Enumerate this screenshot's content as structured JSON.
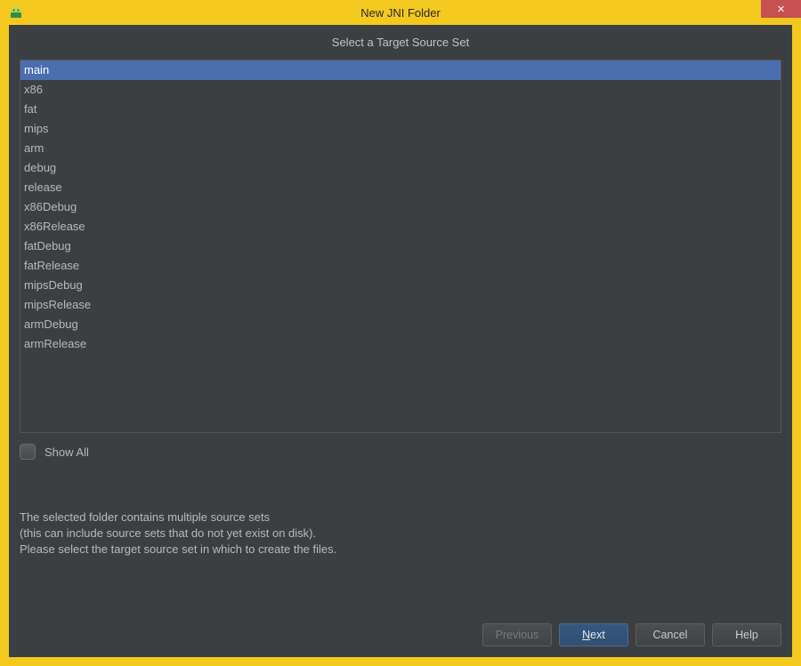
{
  "window": {
    "title": "New JNI Folder"
  },
  "heading": "Select a Target Source Set",
  "source_sets": [
    {
      "label": "main",
      "selected": true
    },
    {
      "label": "x86",
      "selected": false
    },
    {
      "label": "fat",
      "selected": false
    },
    {
      "label": "mips",
      "selected": false
    },
    {
      "label": "arm",
      "selected": false
    },
    {
      "label": "debug",
      "selected": false
    },
    {
      "label": "release",
      "selected": false
    },
    {
      "label": "x86Debug",
      "selected": false
    },
    {
      "label": "x86Release",
      "selected": false
    },
    {
      "label": "fatDebug",
      "selected": false
    },
    {
      "label": "fatRelease",
      "selected": false
    },
    {
      "label": "mipsDebug",
      "selected": false
    },
    {
      "label": "mipsRelease",
      "selected": false
    },
    {
      "label": "armDebug",
      "selected": false
    },
    {
      "label": "armRelease",
      "selected": false
    }
  ],
  "show_all": {
    "label": "Show All",
    "checked": false
  },
  "info": {
    "line1": "The selected folder contains multiple source sets",
    "line2": "(this can include source sets that do not yet exist on disk).",
    "line3": "Please select the target source set in which to create the files."
  },
  "buttons": {
    "previous": "Previous",
    "next_prefix": "",
    "next_mnemonic": "N",
    "next_suffix": "ext",
    "cancel": "Cancel",
    "help": "Help"
  }
}
